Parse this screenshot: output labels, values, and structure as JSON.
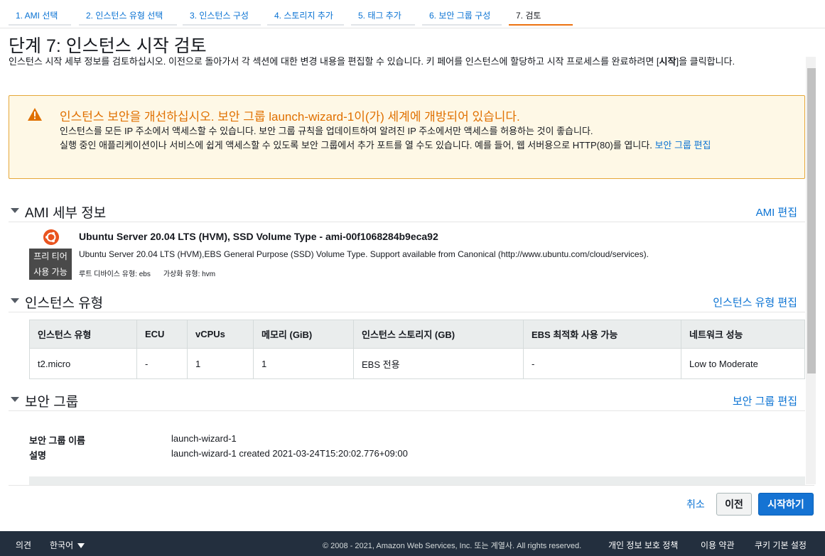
{
  "wizard": {
    "steps": [
      "1. AMI 선택",
      "2. 인스턴스 유형 선택",
      "3. 인스턴스 구성",
      "4. 스토리지 추가",
      "5. 태그 추가",
      "6. 보안 그룹 구성",
      "7. 검토"
    ],
    "active_step": 7
  },
  "page": {
    "title": "단계 7: 인스턴스 시작 검토",
    "desc_prefix": "인스턴스 시작 세부 정보를 검토하십시오. 이전으로 돌아가서 각 섹션에 대한 변경 내용을 편집할 수 있습니다. 키 페어를 인스턴스에 할당하고 시작 프로세스를 완료하려면 [",
    "desc_bold": "시작",
    "desc_suffix": "]을 클릭합니다."
  },
  "warning": {
    "title": "인스턴스 보안을 개선하십시오. 보안 그룹 launch-wizard-1이(가) 세계에 개방되어 있습니다.",
    "line1": "인스턴스를 모든 IP 주소에서 액세스할 수 있습니다. 보안 그룹 규칙을 업데이트하여 알려진 IP 주소에서만 액세스를 허용하는 것이 좋습니다.",
    "line2": "실행 중인 애플리케이션이나 서비스에 쉽게 액세스할 수 있도록 보안 그룹에서 추가 포트를 열 수도 있습니다. 예를 들어, 웹 서버용으로 HTTP(80)를 엽니다.",
    "link": "보안 그룹 편집",
    "color": "#e07000"
  },
  "ami": {
    "section_title": "AMI 세부 정보",
    "edit_link": "AMI 편집",
    "name": "Ubuntu Server 20.04 LTS (HVM), SSD Volume Type - ami-00f1068284b9eca92",
    "desc": "Ubuntu Server 20.04 LTS (HVM),EBS General Purpose (SSD) Volume Type. Support available from Canonical (http://www.ubuntu.com/cloud/services).",
    "badge_line1": "프리 티어",
    "badge_line2": "사용 가능",
    "root_device": "루트 디바이스 유형: ebs",
    "virtualization": "가상화 유형: hvm",
    "icon": "ubuntu-logo-icon"
  },
  "instance_type": {
    "section_title": "인스턴스 유형",
    "edit_link": "인스턴스 유형 편집",
    "headers": [
      "인스턴스 유형",
      "ECU",
      "vCPUs",
      "메모리 (GiB)",
      "인스턴스 스토리지 (GB)",
      "EBS 최적화 사용 가능",
      "네트워크 성능"
    ],
    "row": [
      "t2.micro",
      "-",
      "1",
      "1",
      "EBS 전용",
      "-",
      "Low to Moderate"
    ]
  },
  "security_group": {
    "section_title": "보안 그룹",
    "edit_link": "보안 그룹 편집",
    "name_label": "보안 그룹 이름",
    "name_value": "launch-wizard-1",
    "desc_label": "설명",
    "desc_value": "launch-wizard-1 created 2021-03-24T15:20:02.776+09:00"
  },
  "actions": {
    "cancel": "취소",
    "previous": "이전",
    "launch": "시작하기",
    "launch_color": "#1573d3"
  },
  "footer": {
    "feedback": "의견",
    "language": "한국어",
    "copyright": "© 2008 - 2021, Amazon Web Services, Inc. 또는 계열사. All rights reserved.",
    "privacy": "개인 정보 보호 정책",
    "terms": "이용 약관",
    "cookies": "쿠키 기본 설정"
  }
}
